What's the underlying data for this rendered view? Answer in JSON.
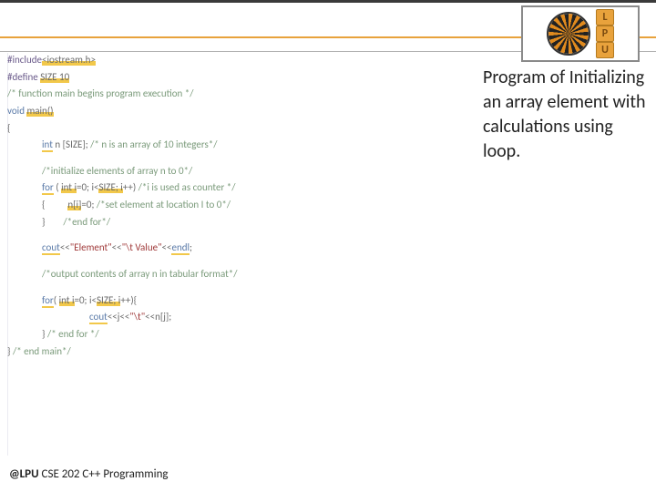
{
  "logo": {
    "letters": [
      "L",
      "P",
      "U"
    ]
  },
  "side": {
    "text": "Program of Initializing an array element with calculations using loop."
  },
  "footer": {
    "bold": "@LPU",
    "rest": " CSE 202 C++ Programming"
  },
  "code": {
    "l01a": "#include",
    "l01b": "<iostream.h>",
    "l02a": "#define ",
    "l02b": "SIZE 10",
    "l03": "/* function main begins program execution */",
    "l04a": "void ",
    "l04b": "main()",
    "l05": "{",
    "l06a": "int",
    "l06b": " n [SIZE]; ",
    "l06c": "/* n is an array of 10 integers*/",
    "l07": "/*initialize elements of array n to 0*/",
    "l08a": "for",
    "l08b": " ( ",
    "l08c": "int i",
    "l08d": "=0; i<",
    "l08e": "SIZE; i",
    "l08f": "++) ",
    "l08g": "/*i is used as counter */",
    "l09a": "{          ",
    "l09b": "n[i]",
    "l09c": "=0; ",
    "l09d": "/*set element at location I to 0*/",
    "l10a": "}        ",
    "l10b": "/*end for*/",
    "l11a": "cout",
    "l11b": "<<",
    "l11c": "\"Element\"",
    "l11d": "<<",
    "l11e": "\"\\t Value\"",
    "l11f": "<<",
    "l11g": "endl",
    "l11h": ";",
    "l12": "/*output contents of array n in tabular format*/",
    "l13a": "for",
    "l13b": "( ",
    "l13c": "int i",
    "l13d": "=0; i<",
    "l13e": "SIZE; i",
    "l13f": "++){",
    "l14a": "cout",
    "l14b": "<<j<<",
    "l14c": "\"\\t\"",
    "l14d": "<<n[j];",
    "l15a": "} ",
    "l15b": "/* end for */",
    "l16a": "} ",
    "l16b": "/* end main*/"
  }
}
